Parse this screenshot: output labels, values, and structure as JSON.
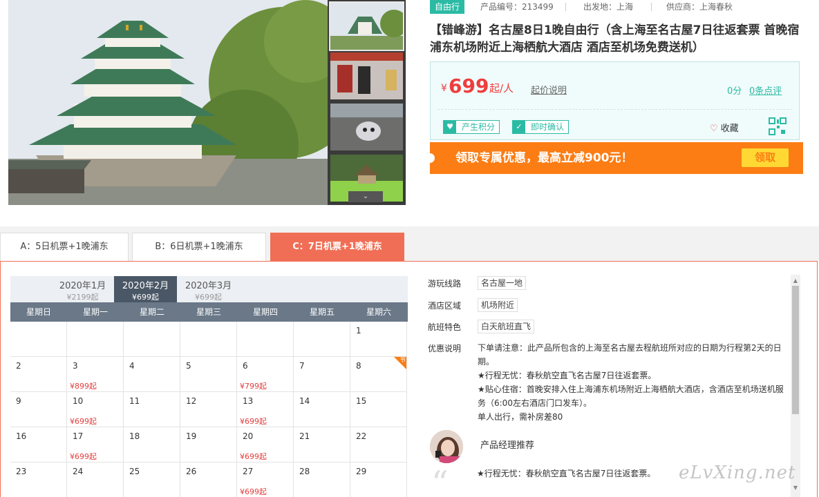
{
  "product": {
    "tag": "自由行",
    "code_label": "产品编号：213499",
    "origin_label": "出发地：上海",
    "supplier_label": "供应商：上海春秋",
    "title": "【错峰游】名古屋8日1晚自由行（含上海至名古屋7日往返套票 首晚宿浦东机场附近上海栖航大酒店 酒店至机场免费送机）",
    "price_currency": "¥",
    "price": "699",
    "price_unit": "起/人",
    "price_explain": "起价说明",
    "score": "0分",
    "reviews": "0条点评",
    "badges": [
      "产生积分",
      "即时确认"
    ],
    "favorite": "收藏",
    "promo_text": "领取专属优惠，最高立减900元！",
    "promo_button": "领取"
  },
  "gallery": {
    "thumb_count": 4
  },
  "packages": [
    {
      "label": "A：5日机票+1晚浦东",
      "active": false
    },
    {
      "label": "B：6日机票+1晚浦东",
      "active": false
    },
    {
      "label": "C：7日机票+1晚浦东",
      "active": true
    }
  ],
  "calendar": {
    "months": [
      {
        "month": "2020年1月",
        "price": "¥2199起",
        "active": false
      },
      {
        "month": "2020年2月",
        "price": "¥699起",
        "active": true
      },
      {
        "month": "2020年3月",
        "price": "¥699起",
        "active": false
      }
    ],
    "weekdays": [
      "星期日",
      "星期一",
      "星期二",
      "星期三",
      "星期四",
      "星期五",
      "星期六"
    ],
    "weeks": [
      [
        {
          "d": ""
        },
        {
          "d": ""
        },
        {
          "d": ""
        },
        {
          "d": ""
        },
        {
          "d": ""
        },
        {
          "d": ""
        },
        {
          "d": "1"
        }
      ],
      [
        {
          "d": "2"
        },
        {
          "d": "3",
          "p": "¥899起"
        },
        {
          "d": "4"
        },
        {
          "d": "5"
        },
        {
          "d": "6",
          "p": "¥799起"
        },
        {
          "d": "7"
        },
        {
          "d": "8",
          "holiday": "节"
        }
      ],
      [
        {
          "d": "9"
        },
        {
          "d": "10",
          "p": "¥699起"
        },
        {
          "d": "11"
        },
        {
          "d": "12"
        },
        {
          "d": "13",
          "p": "¥699起"
        },
        {
          "d": "14"
        },
        {
          "d": "15"
        }
      ],
      [
        {
          "d": "16"
        },
        {
          "d": "17",
          "p": "¥699起"
        },
        {
          "d": "18"
        },
        {
          "d": "19"
        },
        {
          "d": "20",
          "p": "¥699起"
        },
        {
          "d": "21"
        },
        {
          "d": "22"
        }
      ],
      [
        {
          "d": "23"
        },
        {
          "d": "24"
        },
        {
          "d": "25"
        },
        {
          "d": "26"
        },
        {
          "d": "27",
          "p": "¥699起"
        },
        {
          "d": "28"
        },
        {
          "d": "29"
        }
      ]
    ]
  },
  "details": {
    "route_label": "游玩线路",
    "route_value": "名古屋一地",
    "hotel_label": "酒店区域",
    "hotel_value": "机场附近",
    "flight_label": "航班特色",
    "flight_value": "白天航班直飞",
    "offer_label": "优惠说明",
    "offer_lines": [
      "下单请注意：此产品所包含的上海至名古屋去程航班所对应的日期为行程第2天的日期。",
      "★行程无忧：春秋航空直飞名古屋7日往返套票。",
      "★贴心住宿：首晚安排入住上海浦东机场附近上海栖航大酒店，含酒店至机场送机服务（6:00左右酒店门口发车）。",
      "单人出行，需补房差80"
    ],
    "manager_title": "产品经理推荐",
    "manager_text": "★行程无忧：春秋航空直飞名古屋7日往返套票。"
  },
  "watermark": "eLvXing.net",
  "colors": {
    "accent_teal": "#2bbba4",
    "price_red": "#f03c3c",
    "promo_orange": "#fb7d14",
    "tab_active": "#f06e55",
    "calendar_header": "#6a7888"
  }
}
